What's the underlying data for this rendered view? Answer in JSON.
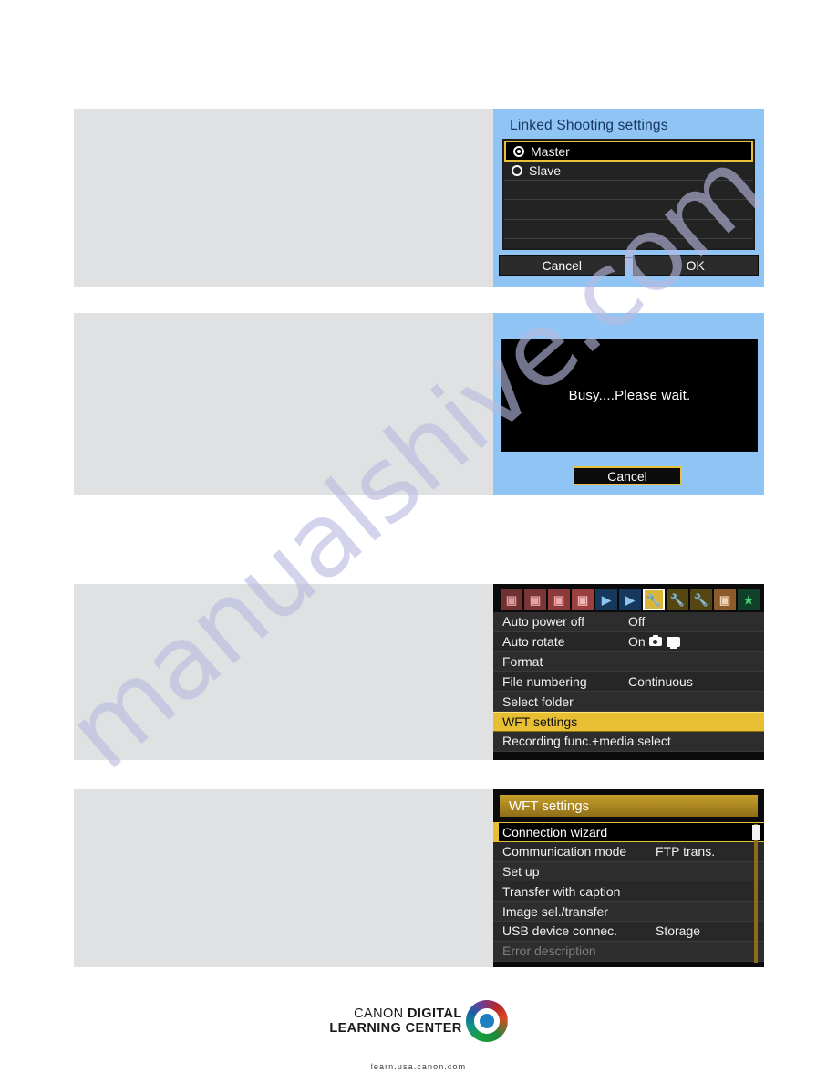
{
  "page": {
    "watermark": "manualshive.com"
  },
  "panel_linked_shooting": {
    "title": "Linked Shooting settings",
    "options": [
      {
        "label": "Master",
        "selected": true,
        "radio_on": true
      },
      {
        "label": "Slave",
        "selected": false,
        "radio_on": false
      }
    ],
    "empty_rows": 4,
    "cancel_label": "Cancel",
    "ok_label": "OK"
  },
  "panel_busy": {
    "message": "Busy....Please wait.",
    "cancel_label": "Cancel"
  },
  "panel_setup_menu": {
    "tabs": [
      {
        "name": "shooting-1",
        "color": "#6e3232",
        "glyph": "⎙"
      },
      {
        "name": "shooting-2",
        "color": "#7a3636",
        "glyph": "⎙"
      },
      {
        "name": "shooting-3",
        "color": "#8c3a3a",
        "glyph": "⎙"
      },
      {
        "name": "shooting-4",
        "color": "#9a4040",
        "glyph": "⎙"
      },
      {
        "name": "playback-1",
        "color": "#1d4f7a",
        "glyph": "▶"
      },
      {
        "name": "playback-2",
        "color": "#1d4f7a",
        "glyph": "▶"
      },
      {
        "name": "setup-1",
        "color": "#c9a533",
        "glyph": "⚒",
        "active": true
      },
      {
        "name": "setup-2",
        "color": "#6b5a18",
        "glyph": "⚒"
      },
      {
        "name": "setup-3",
        "color": "#6b5a18",
        "glyph": "⚒"
      },
      {
        "name": "custom-functions",
        "color": "#8c5b2c",
        "glyph": "▣"
      },
      {
        "name": "my-menu",
        "color": "#1c5c33",
        "glyph": "★"
      }
    ],
    "items": [
      {
        "label": "Auto power off",
        "value": "Off"
      },
      {
        "label": "Auto rotate",
        "value": "On",
        "icons": [
          "camera-icon",
          "monitor-icon"
        ]
      },
      {
        "label": "Format",
        "value": ""
      },
      {
        "label": "File numbering",
        "value": "Continuous"
      },
      {
        "label": "Select folder",
        "value": ""
      },
      {
        "label": "WFT settings",
        "value": "",
        "highlighted": true
      },
      {
        "label": "Recording func.+media select",
        "value": ""
      }
    ]
  },
  "panel_wft_settings": {
    "title": "WFT settings",
    "items": [
      {
        "label": "Connection wizard",
        "value": "",
        "selected": true
      },
      {
        "label": "Communication mode",
        "value": "FTP trans."
      },
      {
        "label": "Set up",
        "value": ""
      },
      {
        "label": "Transfer with caption",
        "value": ""
      },
      {
        "label": "Image sel./transfer",
        "value": ""
      },
      {
        "label": "USB device connec.",
        "value": "Storage"
      },
      {
        "label": "Error description",
        "value": "",
        "disabled": true
      }
    ]
  },
  "footer": {
    "logo_line1_regular": "CANON ",
    "logo_line1_bold": "DIGITAL",
    "logo_line2_bold": "LEARNING CENTER",
    "url": "learn.usa.canon.com"
  }
}
